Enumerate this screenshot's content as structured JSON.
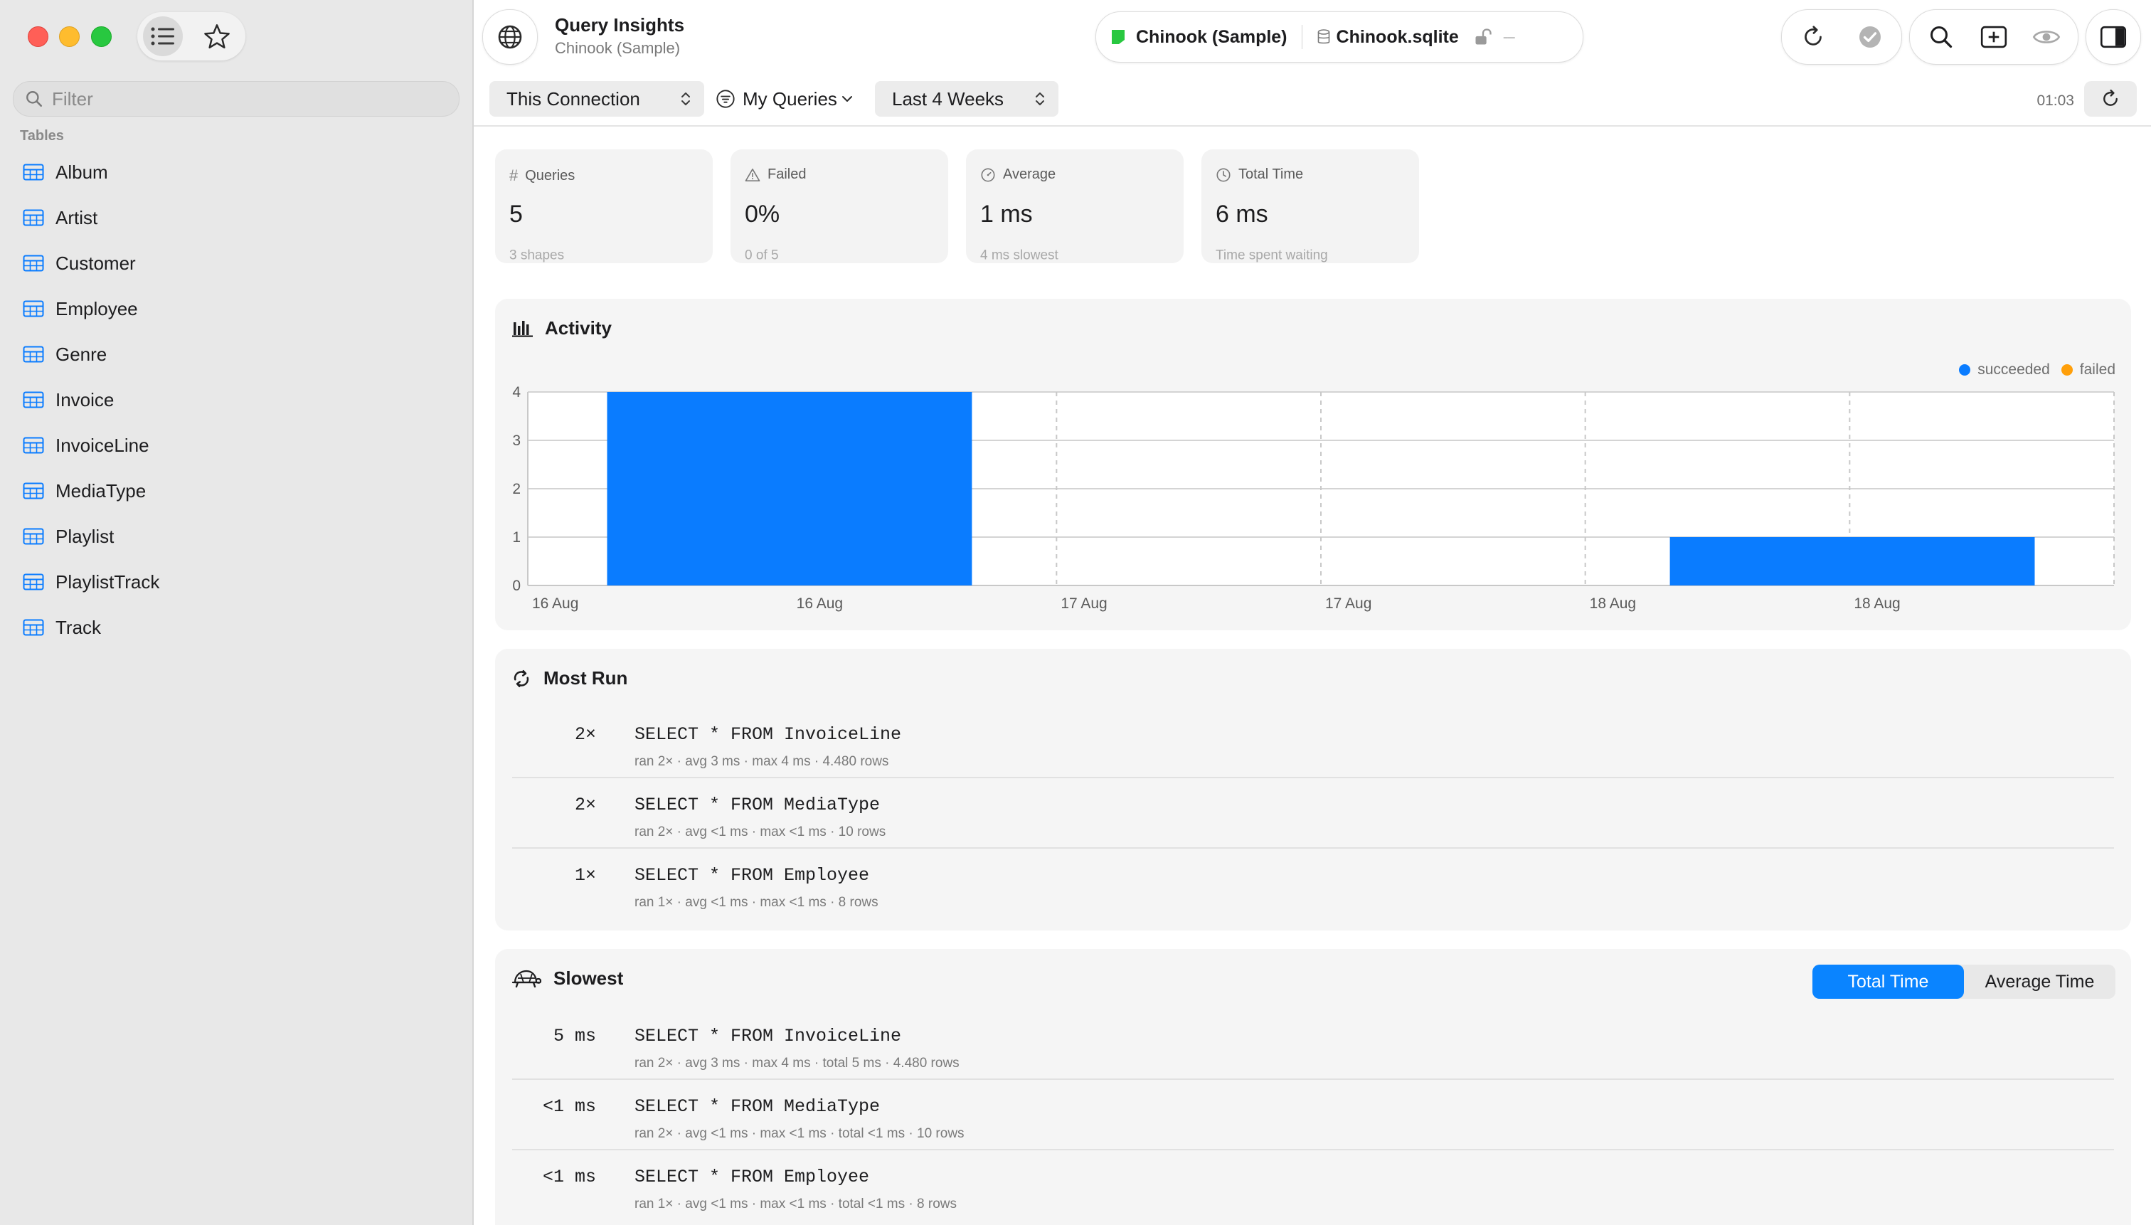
{
  "sidebar": {
    "filter_placeholder": "Filter",
    "section_label": "Tables",
    "tables": [
      "Album",
      "Artist",
      "Customer",
      "Employee",
      "Genre",
      "Invoice",
      "InvoiceLine",
      "MediaType",
      "Playlist",
      "PlaylistTrack",
      "Track"
    ]
  },
  "toolbar": {
    "title": "Query Insights",
    "subtitle": "Chinook (Sample)",
    "connection_name": "Chinook (Sample)",
    "connection_color": "#28c840",
    "database_file": "Chinook.sqlite",
    "connection_status": "---"
  },
  "filterbar": {
    "scope": "This Connection",
    "query_filter": "My Queries",
    "time_range": "Last 4 Weeks",
    "elapsed": "01:03"
  },
  "stats": [
    {
      "label": "Queries",
      "icon": "hash-icon",
      "value": "5",
      "sub": "3 shapes"
    },
    {
      "label": "Failed",
      "icon": "warning-icon",
      "value": "0%",
      "sub": "0 of 5"
    },
    {
      "label": "Average",
      "icon": "gauge-icon",
      "value": "1 ms",
      "sub": "4 ms slowest"
    },
    {
      "label": "Total Time",
      "icon": "clock-icon",
      "value": "6 ms",
      "sub": "Time spent waiting"
    }
  ],
  "activity": {
    "title": "Activity",
    "legend": [
      {
        "label": "succeeded",
        "color": "#0a7cff"
      },
      {
        "label": "failed",
        "color": "#ff9f0a"
      }
    ]
  },
  "chart_data": {
    "type": "bar",
    "title": "Activity",
    "x_ticks": [
      "16 Aug",
      "16 Aug",
      "17 Aug",
      "17 Aug",
      "18 Aug",
      "18 Aug"
    ],
    "ylim": [
      0,
      4
    ],
    "y_ticks": [
      "0",
      "1",
      "2",
      "3",
      "4"
    ],
    "grid": true,
    "legend_position": "top-right",
    "series": [
      {
        "name": "succeeded",
        "color": "#0a7cff",
        "bars": [
          {
            "start": 0.05,
            "end": 0.28,
            "value": 4
          },
          {
            "start": 0.72,
            "end": 0.95,
            "value": 1
          }
        ]
      },
      {
        "name": "failed",
        "color": "#ff9f0a",
        "bars": []
      }
    ]
  },
  "most_run": {
    "title": "Most Run",
    "rows": [
      {
        "count": "2×",
        "sql": "SELECT * FROM InvoiceLine",
        "meta": "ran 2× · avg 3 ms · max 4 ms · 4.480 rows"
      },
      {
        "count": "2×",
        "sql": "SELECT * FROM MediaType",
        "meta": "ran 2× · avg <1 ms · max <1 ms · 10 rows"
      },
      {
        "count": "1×",
        "sql": "SELECT * FROM Employee",
        "meta": "ran 1× · avg <1 ms · max <1 ms · 8 rows"
      }
    ]
  },
  "slowest": {
    "title": "Slowest",
    "segments": [
      "Total Time",
      "Average Time"
    ],
    "accent": "#0a84ff",
    "rows": [
      {
        "count": "5 ms",
        "sql": "SELECT * FROM InvoiceLine",
        "meta": "ran 2× · avg 3 ms · max 4 ms · total 5 ms · 4.480 rows"
      },
      {
        "count": "<1 ms",
        "sql": "SELECT * FROM MediaType",
        "meta": "ran 2× · avg <1 ms · max <1 ms · total <1 ms · 10 rows"
      },
      {
        "count": "<1 ms",
        "sql": "SELECT * FROM Employee",
        "meta": "ran 1× · avg <1 ms · max <1 ms · total <1 ms · 8 rows"
      }
    ]
  }
}
